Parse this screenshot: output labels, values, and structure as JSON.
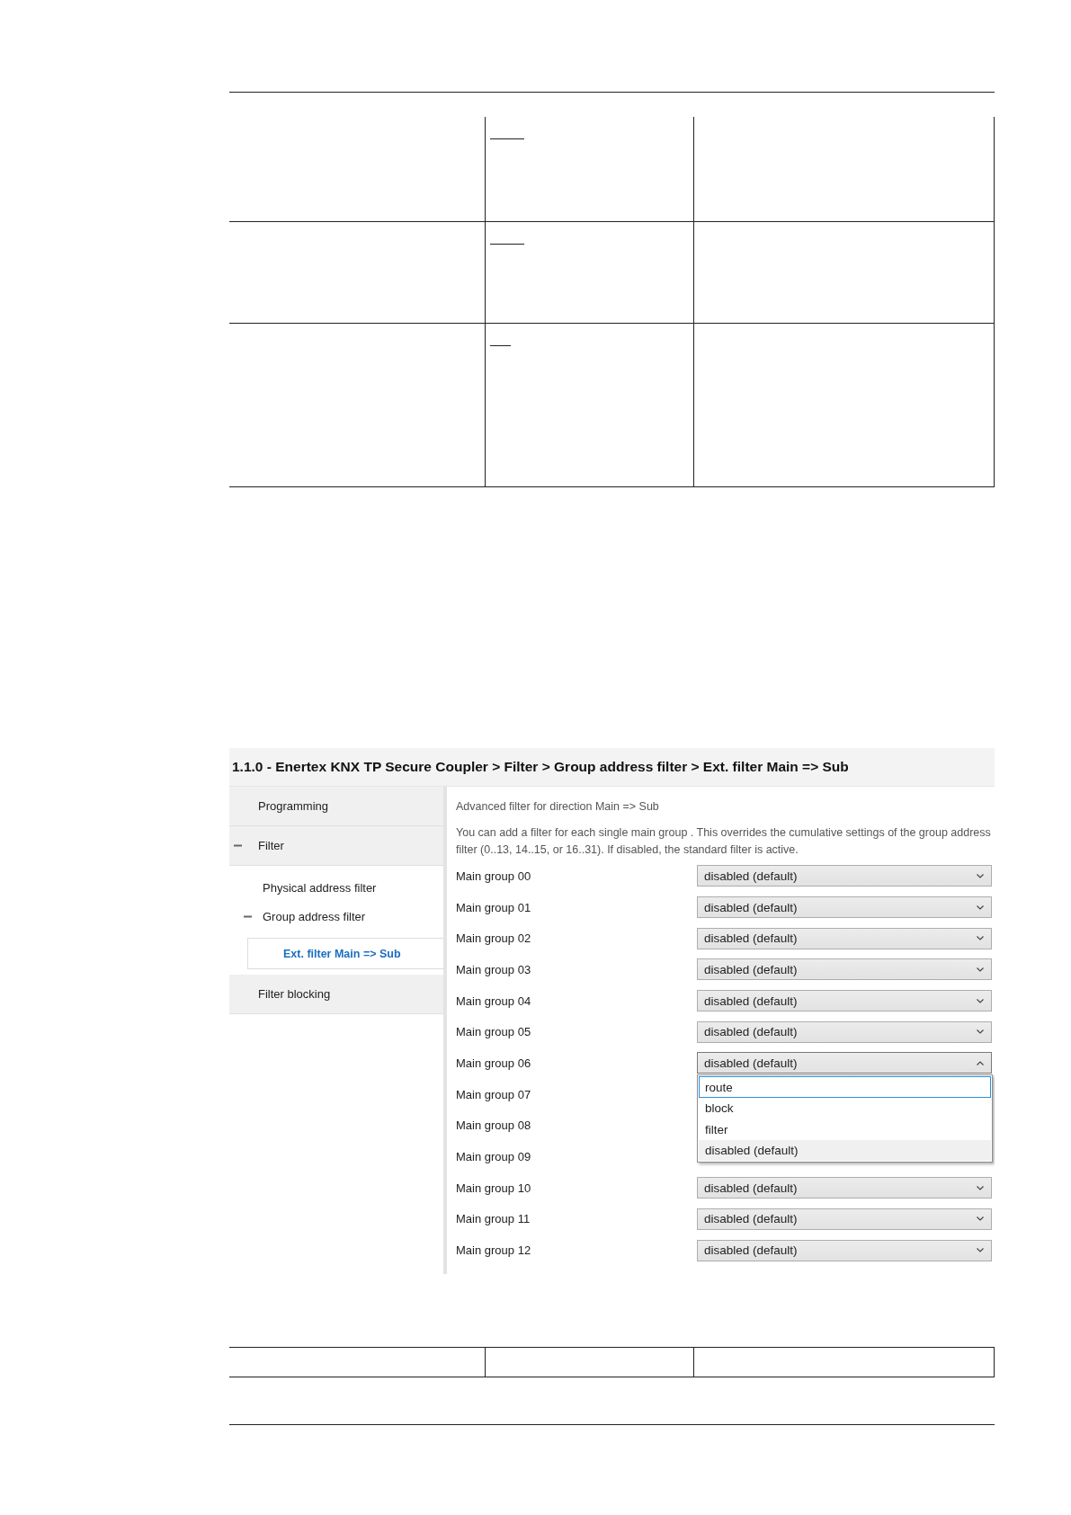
{
  "window": {
    "breadcrumb": "1.1.0 - Enertex KNX TP Secure Coupler > Filter > Group address filter > Ext. filter Main => Sub"
  },
  "sidebar": {
    "items": [
      {
        "label": "Programming",
        "selected": false
      },
      {
        "label": "Filter",
        "selected": false,
        "expanded": true,
        "children": [
          {
            "label": "Physical address filter",
            "selected": false
          },
          {
            "label": "Group address filter",
            "selected": false,
            "expanded": true,
            "children": [
              {
                "label": "Ext. filter Main => Sub",
                "selected": true
              }
            ]
          }
        ]
      },
      {
        "label": "Filter blocking",
        "selected": false
      }
    ]
  },
  "content": {
    "heading": "Advanced filter for direction Main => Sub",
    "description": "You can add a filter for each single main group . This overrides the cumulative settings of the group address filter (0..13, 14..15, or 16..31). If disabled, the standard filter is active.",
    "params": [
      {
        "label": "Main group 00",
        "value": "disabled (default)"
      },
      {
        "label": "Main group 01",
        "value": "disabled (default)"
      },
      {
        "label": "Main group 02",
        "value": "disabled (default)"
      },
      {
        "label": "Main group 03",
        "value": "disabled (default)"
      },
      {
        "label": "Main group 04",
        "value": "disabled (default)"
      },
      {
        "label": "Main group 05",
        "value": "disabled (default)"
      },
      {
        "label": "Main group 06",
        "value": "disabled (default)",
        "open": true,
        "options": [
          {
            "label": "route",
            "selected": false,
            "focused": true
          },
          {
            "label": "block",
            "selected": false,
            "focused": false
          },
          {
            "label": "filter",
            "selected": false,
            "focused": false
          },
          {
            "label": "disabled (default)",
            "selected": true,
            "focused": false
          }
        ]
      },
      {
        "label": "Main group 07"
      },
      {
        "label": "Main group 08"
      },
      {
        "label": "Main group 09"
      },
      {
        "label": "Main group 10",
        "value": "disabled (default)"
      },
      {
        "label": "Main group 11",
        "value": "disabled (default)"
      },
      {
        "label": "Main group 12",
        "value": "disabled (default)"
      }
    ]
  }
}
